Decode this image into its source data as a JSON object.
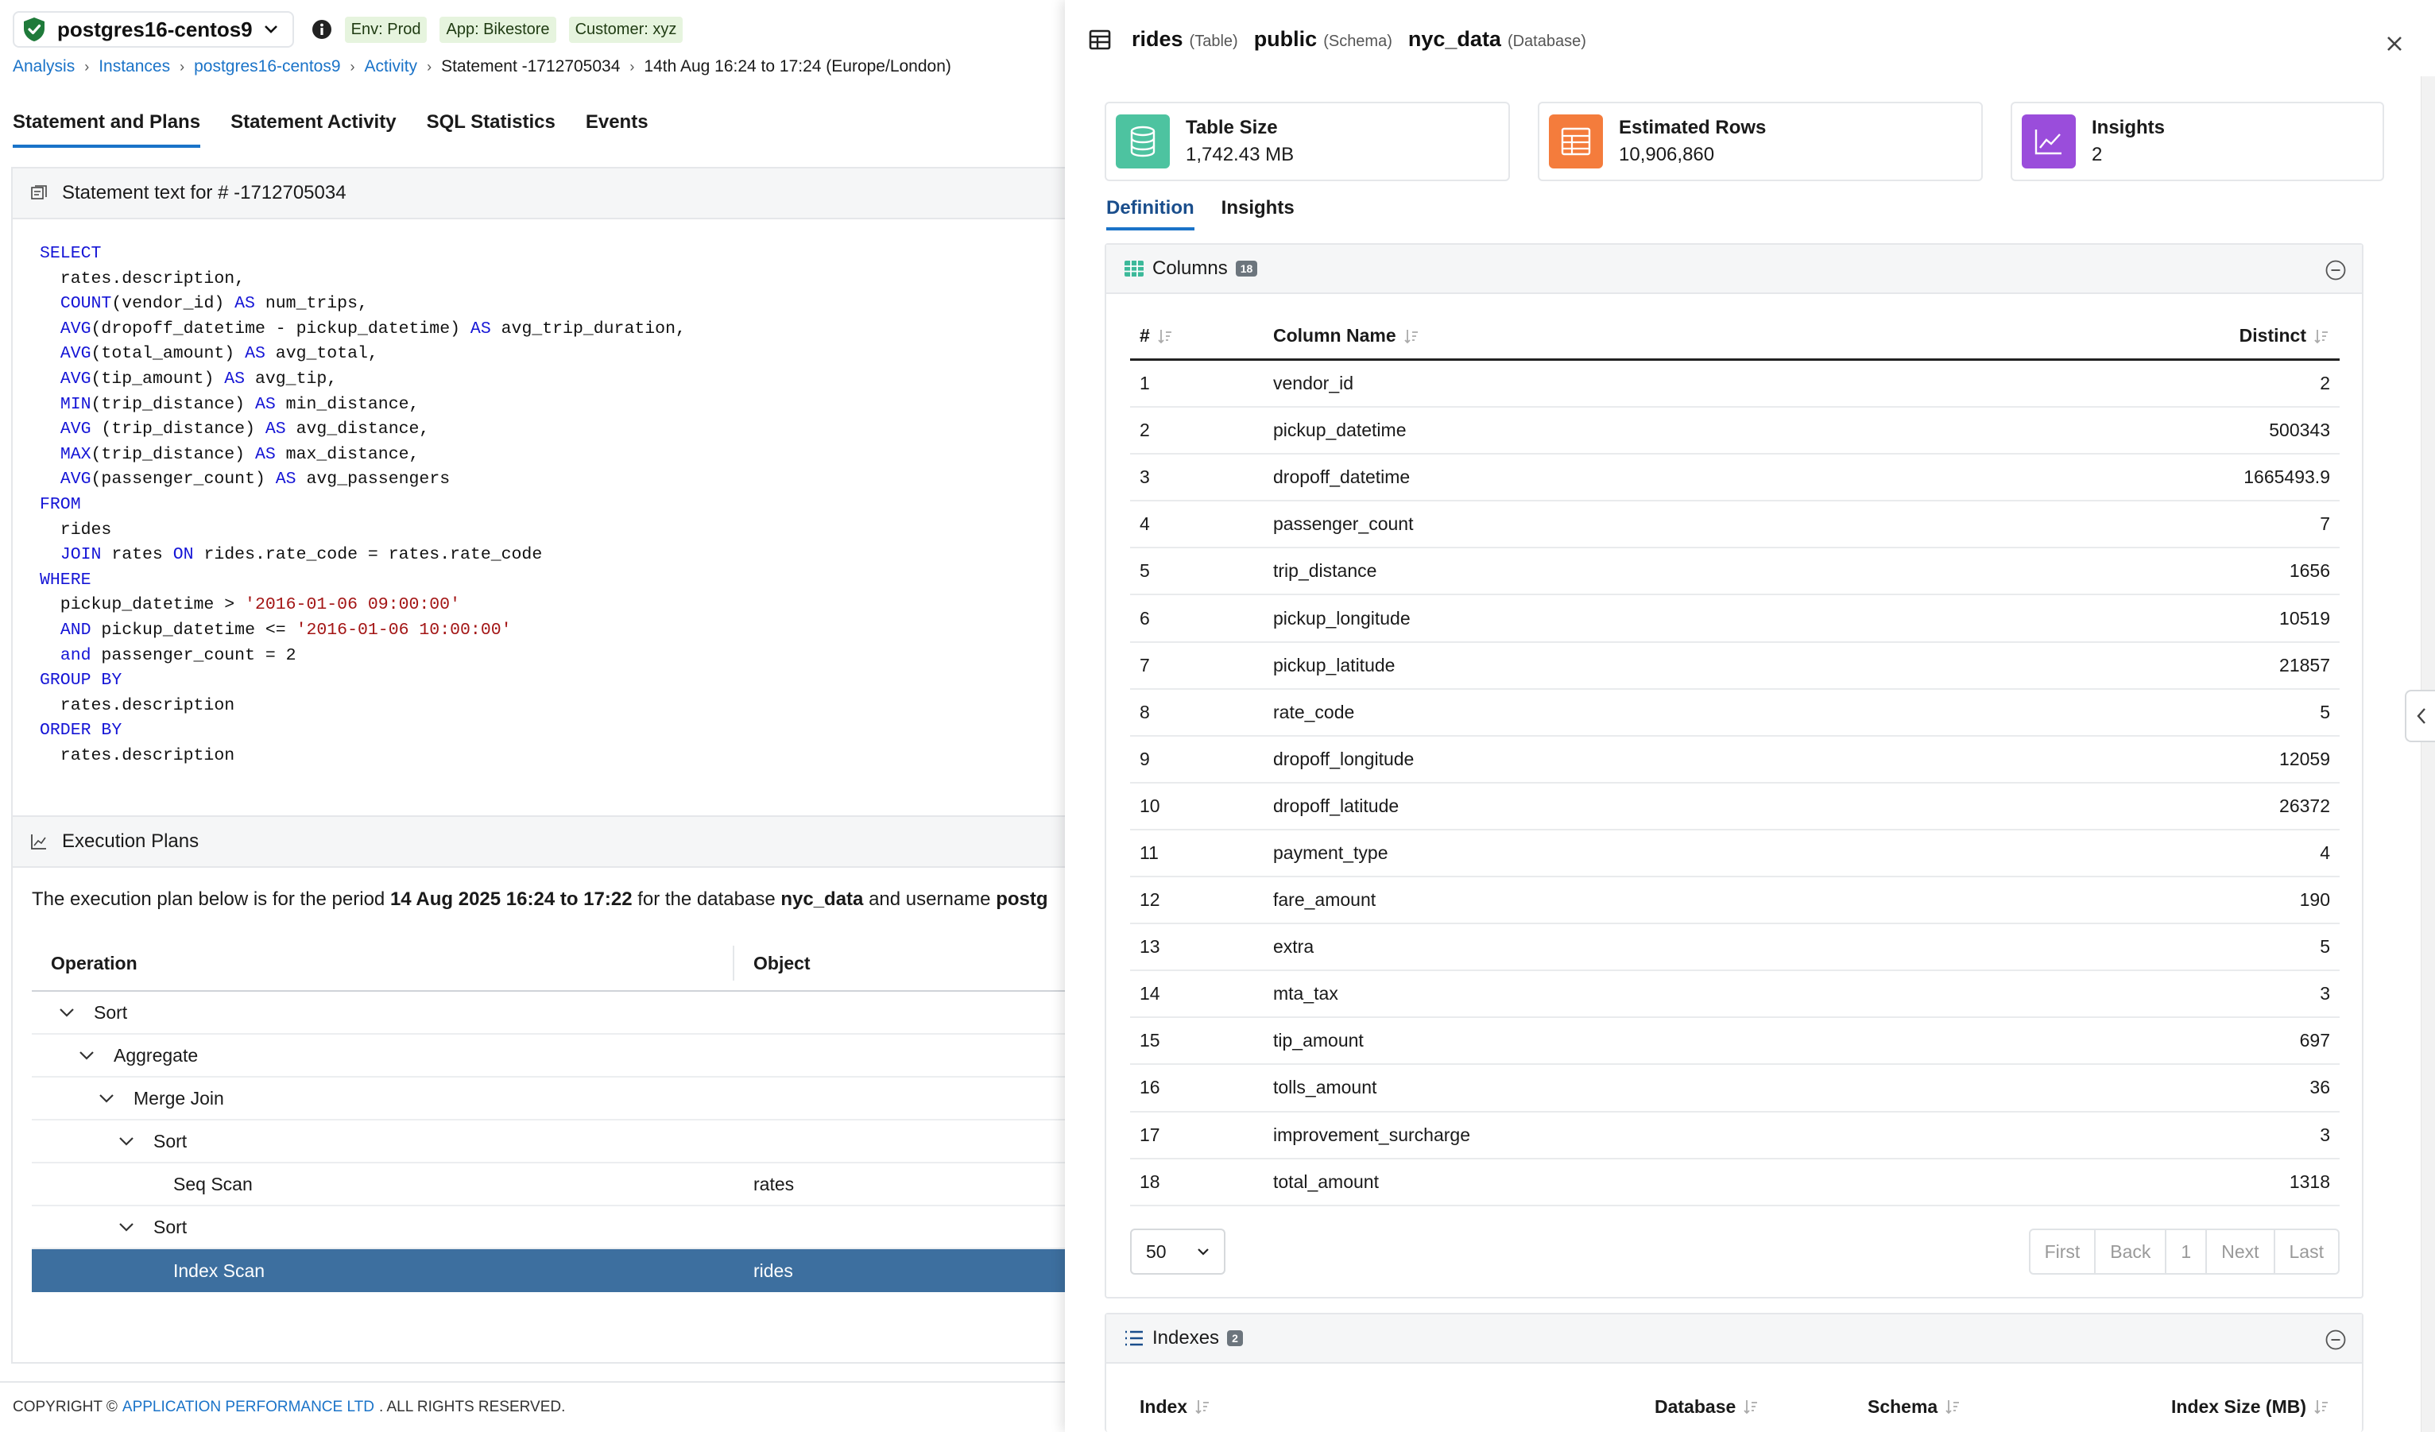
{
  "topbar": {
    "instance": "postgres16-centos9",
    "tags": [
      "Env: Prod",
      "App: Bikestore",
      "Customer: xyz"
    ]
  },
  "breadcrumb": {
    "items": [
      "Analysis",
      "Instances",
      "postgres16-centos9",
      "Activity"
    ],
    "statement": "Statement -1712705034",
    "period": "14th Aug 16:24 to 17:24 (Europe/London)"
  },
  "tabs": [
    "Statement and Plans",
    "Statement Activity",
    "SQL Statistics",
    "Events"
  ],
  "statement_panel": {
    "title": "Statement text for # -1712705034"
  },
  "plans_panel": {
    "title": "Execution Plans",
    "desc_prefix": "The execution plan below is for the period ",
    "desc_period": "14 Aug 2025 16:24 to 17:22",
    "desc_mid": " for the database ",
    "desc_db": "nyc_data",
    "desc_suffix": " and username ",
    "desc_user": "postg",
    "col_operation": "Operation",
    "col_object": "Object",
    "rows": [
      {
        "op": "Sort",
        "obj": "",
        "level": 0,
        "expand": true
      },
      {
        "op": "Aggregate",
        "obj": "",
        "level": 1,
        "expand": true
      },
      {
        "op": "Merge Join",
        "obj": "",
        "level": 2,
        "expand": true
      },
      {
        "op": "Sort",
        "obj": "",
        "level": 3,
        "expand": true
      },
      {
        "op": "Seq Scan",
        "obj": "rates",
        "level": 4,
        "expand": false
      },
      {
        "op": "Sort",
        "obj": "",
        "level": 3,
        "expand": true
      },
      {
        "op": "Index Scan",
        "obj": "rides",
        "level": 4,
        "expand": false,
        "selected": true
      }
    ]
  },
  "footer": {
    "prefix": "COPYRIGHT ©",
    "company": "APPLICATION PERFORMANCE LTD",
    "suffix": ". ALL RIGHTS RESERVED."
  },
  "drawer": {
    "table": "rides",
    "table_type": "(Table)",
    "schema": "public",
    "schema_type": "(Schema)",
    "database": "nyc_data",
    "database_type": "(Database)",
    "cards": [
      {
        "label": "Table Size",
        "value": "1,742.43 MB",
        "color": "#4dc3a0"
      },
      {
        "label": "Estimated Rows",
        "value": "10,906,860",
        "color": "#f47c3c"
      },
      {
        "label": "Insights",
        "value": "2",
        "color": "#9a4ddb"
      }
    ],
    "tabs": [
      "Definition",
      "Insights"
    ],
    "columns_section": {
      "title": "Columns",
      "count": "18",
      "hdr_num": "#",
      "hdr_name": "Column Name",
      "hdr_distinct": "Distinct",
      "rows": [
        {
          "n": "1",
          "name": "vendor_id",
          "distinct": "2"
        },
        {
          "n": "2",
          "name": "pickup_datetime",
          "distinct": "500343"
        },
        {
          "n": "3",
          "name": "dropoff_datetime",
          "distinct": "1665493.9"
        },
        {
          "n": "4",
          "name": "passenger_count",
          "distinct": "7"
        },
        {
          "n": "5",
          "name": "trip_distance",
          "distinct": "1656"
        },
        {
          "n": "6",
          "name": "pickup_longitude",
          "distinct": "10519"
        },
        {
          "n": "7",
          "name": "pickup_latitude",
          "distinct": "21857"
        },
        {
          "n": "8",
          "name": "rate_code",
          "distinct": "5"
        },
        {
          "n": "9",
          "name": "dropoff_longitude",
          "distinct": "12059"
        },
        {
          "n": "10",
          "name": "dropoff_latitude",
          "distinct": "26372"
        },
        {
          "n": "11",
          "name": "payment_type",
          "distinct": "4"
        },
        {
          "n": "12",
          "name": "fare_amount",
          "distinct": "190"
        },
        {
          "n": "13",
          "name": "extra",
          "distinct": "5"
        },
        {
          "n": "14",
          "name": "mta_tax",
          "distinct": "3"
        },
        {
          "n": "15",
          "name": "tip_amount",
          "distinct": "697"
        },
        {
          "n": "16",
          "name": "tolls_amount",
          "distinct": "36"
        },
        {
          "n": "17",
          "name": "improvement_surcharge",
          "distinct": "3"
        },
        {
          "n": "18",
          "name": "total_amount",
          "distinct": "1318"
        }
      ],
      "page_size": "50",
      "pager": [
        "First",
        "Back",
        "1",
        "Next",
        "Last"
      ]
    },
    "indexes_section": {
      "title": "Indexes",
      "count": "2",
      "headers": [
        "Index",
        "Database",
        "Schema",
        "Index Size (MB)"
      ]
    }
  }
}
